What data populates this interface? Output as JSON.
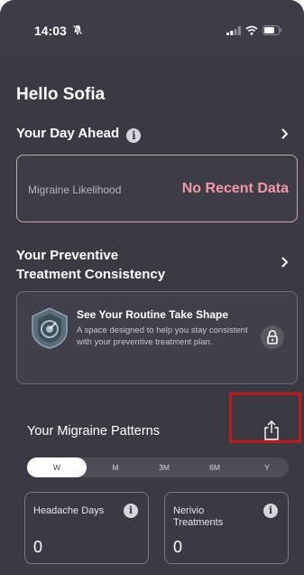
{
  "status_bar": {
    "time": "14:03",
    "bell_icon": "bell-slash-icon",
    "signal_icon": "cellular-signal-icon",
    "wifi_icon": "wifi-icon",
    "battery_icon": "battery-icon"
  },
  "greeting": "Hello Sofia",
  "day_ahead": {
    "title": "Your Day Ahead",
    "info_glyph": "i",
    "likelihood_label": "Migraine Likelihood",
    "likelihood_value": "No Recent Data"
  },
  "preventive": {
    "title_line1": "Your Preventive",
    "title_line2": "Treatment Consistency",
    "card_title": "See Your Routine Take Shape",
    "card_desc": "A space designed to help you stay consistent with your preventive treatment plan."
  },
  "patterns": {
    "title": "Your Migraine Patterns",
    "ranges": [
      "W",
      "M",
      "3M",
      "6M",
      "Y"
    ],
    "selected_range": "W"
  },
  "stats": [
    {
      "label": "Headache Days",
      "value": "0",
      "info_glyph": "i"
    },
    {
      "label": "Nerivio Treatments",
      "value": "0",
      "info_glyph": "i"
    }
  ],
  "colors": {
    "background": "#3b3a43",
    "accent_pink": "#f19aa6",
    "highlight_box": "#c01a1a"
  }
}
